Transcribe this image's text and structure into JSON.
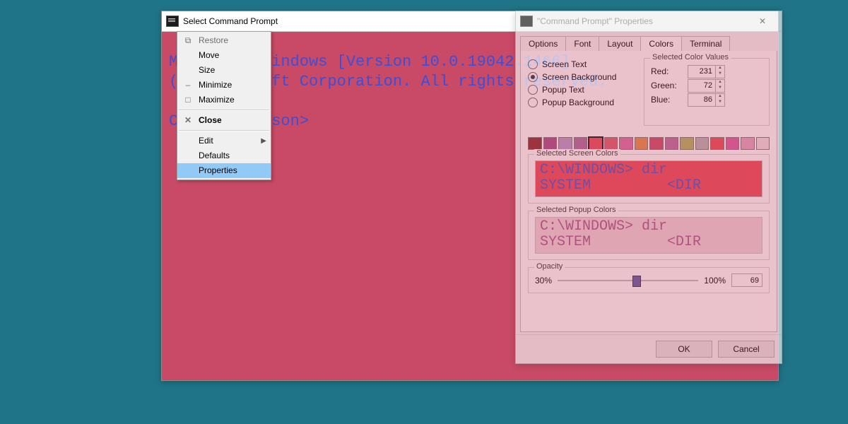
{
  "cmd_window": {
    "title": "Select Command Prompt",
    "lines": [
      "Microsoft Windows [Version 10.0.19042.1466]",
      "(c) Microsoft Corporation. All rights reserved.",
      "",
      "C:\\Users\\Jason>"
    ]
  },
  "context_menu": {
    "items": [
      {
        "label": "Restore",
        "glyph": "⧉",
        "disabled": true
      },
      {
        "label": "Move"
      },
      {
        "label": "Size"
      },
      {
        "label": "Minimize",
        "glyph": "–"
      },
      {
        "label": "Maximize",
        "glyph": "□"
      },
      {
        "sep": true
      },
      {
        "label": "Close",
        "glyph": "✕",
        "bold": true
      },
      {
        "sep": true
      },
      {
        "label": "Edit",
        "sub": true
      },
      {
        "label": "Defaults"
      },
      {
        "label": "Properties",
        "hover": true
      }
    ]
  },
  "props": {
    "title": "\"Command Prompt\" Properties",
    "tabs": [
      "Options",
      "Font",
      "Layout",
      "Colors",
      "Terminal"
    ],
    "active_tab": 3,
    "radios": [
      "Screen Text",
      "Screen Background",
      "Popup Text",
      "Popup Background"
    ],
    "radio_checked": 1,
    "colorvals": {
      "legend": "Selected Color Values",
      "red_label": "Red:",
      "green_label": "Green:",
      "blue_label": "Blue:",
      "red": 231,
      "green": 72,
      "blue": 86
    },
    "palette": [
      {
        "hex": "#8b2a2a"
      },
      {
        "hex": "#a64a8a"
      },
      {
        "hex": "#b497c6"
      },
      {
        "hex": "#a86aa0"
      },
      {
        "hex": "#e74856",
        "sel": true
      },
      {
        "hex": "#d85a6c"
      },
      {
        "hex": "#d96aa0"
      },
      {
        "hex": "#e08a4a"
      },
      {
        "hex": "#c84a66"
      },
      {
        "hex": "#b86aa0"
      },
      {
        "hex": "#b0b060"
      },
      {
        "hex": "#b0b0b0"
      },
      {
        "hex": "#e74856"
      },
      {
        "hex": "#d85aa0"
      },
      {
        "hex": "#e0a0c0"
      },
      {
        "hex": "#ecd8e0"
      }
    ],
    "screen_preview": {
      "legend": "Selected Screen Colors",
      "bg": "#e74856",
      "fg": "#4a50c0",
      "line1": "C:\\WINDOWS> dir",
      "line2": "SYSTEM         <DIR"
    },
    "popup_preview": {
      "legend": "Selected Popup Colors",
      "bg": "#eacfd5",
      "fg": "#a4568c",
      "line1": "C:\\WINDOWS> dir",
      "line2": "SYSTEM         <DIR"
    },
    "opacity": {
      "legend": "Opacity",
      "min_label": "30%",
      "max_label": "100%",
      "value": 69
    },
    "ok": "OK",
    "cancel": "Cancel"
  }
}
